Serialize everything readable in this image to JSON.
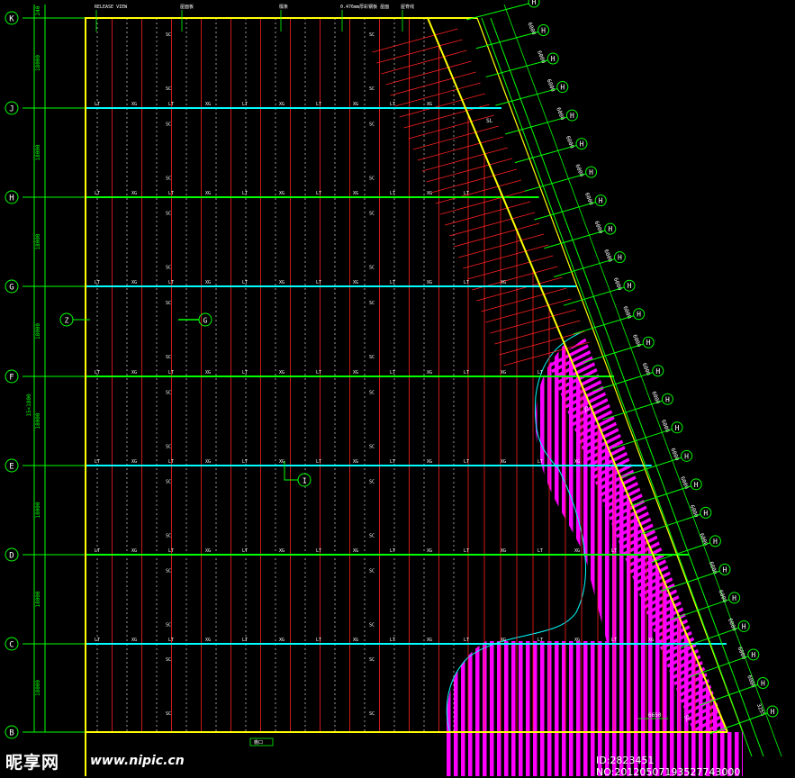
{
  "grid_rows": [
    {
      "label": "K"
    },
    {
      "label": "J"
    },
    {
      "label": "H"
    },
    {
      "label": "G"
    },
    {
      "label": "F"
    },
    {
      "label": "E"
    },
    {
      "label": "D"
    },
    {
      "label": "C"
    },
    {
      "label": "B"
    }
  ],
  "row_spacings": [
    "18000",
    "18000",
    "18000",
    "18000",
    "18000",
    "18000",
    "18000",
    "18000"
  ],
  "top_dim": "240",
  "total_dim": "15×1800",
  "diag_bays": [
    "6000",
    "6000",
    "6000",
    "6000",
    "6000",
    "6000",
    "6000",
    "6000",
    "6000",
    "6000",
    "6000",
    "6000",
    "6000",
    "6000",
    "6000",
    "6000",
    "6000",
    "6000",
    "6000",
    "6000",
    "6000",
    "6000",
    "6000",
    "6000",
    "3255"
  ],
  "diag_axis_label": "H",
  "purlin_tag": "LT",
  "tie_tag": "XG",
  "brace_tag": "SC",
  "edge_tag": "SL",
  "callout_left": "Z",
  "callout_mid": "G",
  "callout_center": "1",
  "top_notes": [
    "RELEASE VIEW",
    "屋面板",
    "檩条",
    "0.476mm厚彩钢板 屋面",
    "屋脊线"
  ],
  "bottom_note": "檐口",
  "bottom_dim": "6650",
  "watermark": {
    "logo": "昵享网",
    "url": "www.nipic.cn",
    "id": "ID:2823451 NO:20120507193527743000"
  },
  "colors": {
    "yellow": "#ffff00",
    "green": "#00ff00",
    "cyan": "#00ffff",
    "red": "#ff0000",
    "magenta": "#ff00ff",
    "white": "#ffffff"
  }
}
